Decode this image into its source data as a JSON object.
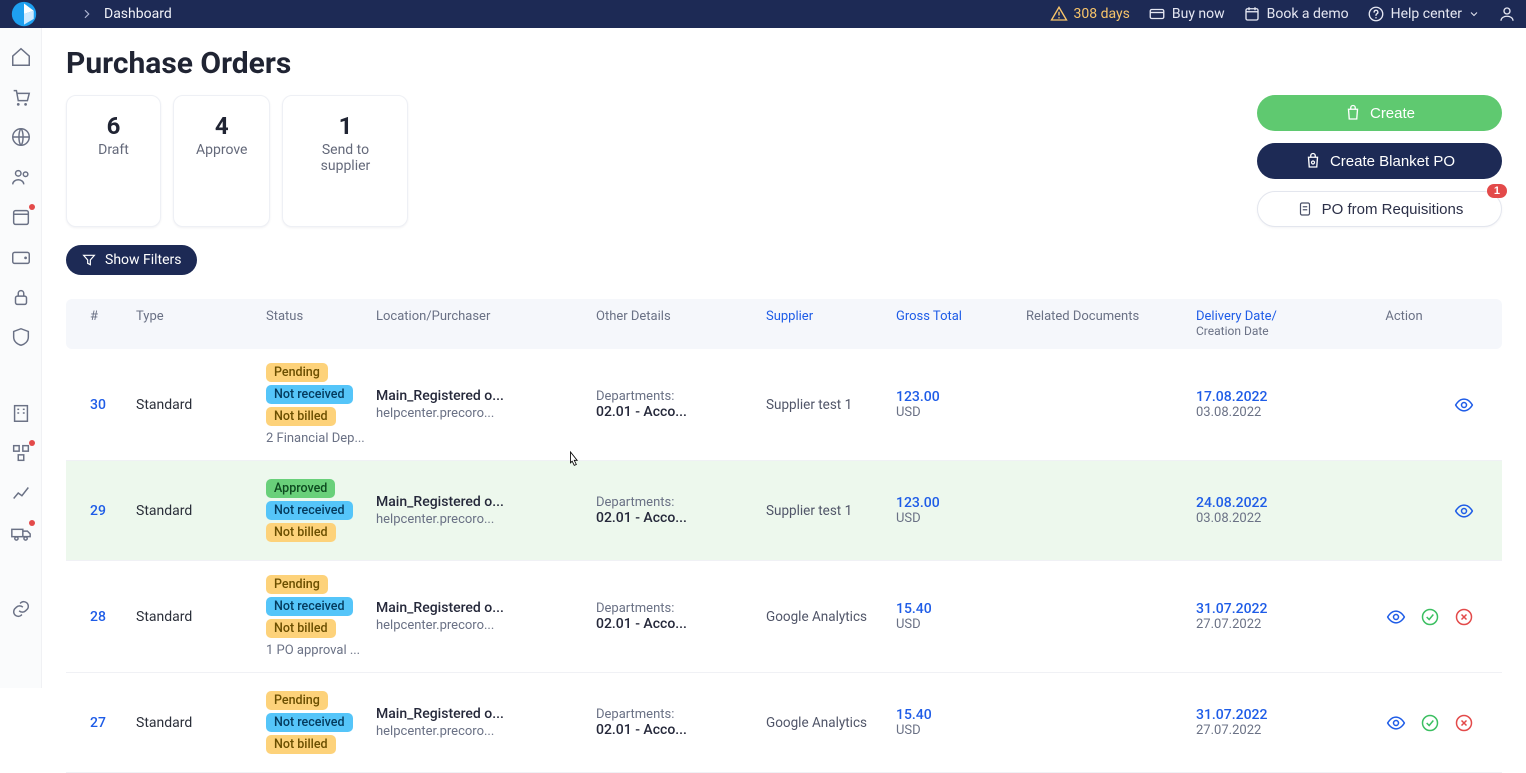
{
  "header": {
    "breadcrumb": "Dashboard",
    "countdown": "308 days",
    "buy_now": "Buy now",
    "book_demo": "Book a demo",
    "help_center": "Help center"
  },
  "page": {
    "title": "Purchase Orders"
  },
  "status_cards": [
    {
      "count": "6",
      "label": "Draft"
    },
    {
      "count": "4",
      "label": "Approve"
    },
    {
      "count": "1",
      "label": "Send to supplier"
    }
  ],
  "buttons": {
    "create": "Create",
    "create_blanket": "Create Blanket PO",
    "po_from_req": "PO from Requisitions",
    "po_from_req_badge": "1",
    "show_filters": "Show Filters"
  },
  "columns": {
    "num": "#",
    "type": "Type",
    "status": "Status",
    "location": "Location/Purchaser",
    "other": "Other Details",
    "supplier": "Supplier",
    "gross": "Gross Total",
    "related": "Related Documents",
    "date1": "Delivery Date/",
    "date2": "Creation Date",
    "action": "Action"
  },
  "rows": [
    {
      "num": "30",
      "type": "Standard",
      "statuses": [
        {
          "text": "Pending",
          "class": "pill-yellow"
        },
        {
          "text": "Not received",
          "class": "pill-blue"
        },
        {
          "text": "Not billed",
          "class": "pill-yellow"
        }
      ],
      "status_extra": "2 Financial Dep...",
      "loc1": "Main_Registered o...",
      "loc2": "helpcenter.precoro...",
      "other1": "Departments:",
      "other2": "02.01 - Acco...",
      "supplier": "Supplier test 1",
      "gross_amount": "123.00",
      "gross_currency": "USD",
      "date1": "17.08.2022",
      "date2": "03.08.2022",
      "actions": [
        "eye"
      ],
      "hovered": false
    },
    {
      "num": "29",
      "type": "Standard",
      "statuses": [
        {
          "text": "Approved",
          "class": "pill-green"
        },
        {
          "text": "Not received",
          "class": "pill-blue"
        },
        {
          "text": "Not billed",
          "class": "pill-yellow"
        }
      ],
      "status_extra": "",
      "loc1": "Main_Registered o...",
      "loc2": "helpcenter.precoro...",
      "other1": "Departments:",
      "other2": "02.01 - Acco...",
      "supplier": "Supplier test 1",
      "gross_amount": "123.00",
      "gross_currency": "USD",
      "date1": "24.08.2022",
      "date2": "03.08.2022",
      "actions": [
        "eye"
      ],
      "hovered": true
    },
    {
      "num": "28",
      "type": "Standard",
      "statuses": [
        {
          "text": "Pending",
          "class": "pill-yellow"
        },
        {
          "text": "Not received",
          "class": "pill-blue"
        },
        {
          "text": "Not billed",
          "class": "pill-yellow"
        }
      ],
      "status_extra": "1 PO approval ...",
      "loc1": "Main_Registered o...",
      "loc2": "helpcenter.precoro...",
      "other1": "Departments:",
      "other2": "02.01 - Acco...",
      "supplier": "Google Analytics",
      "gross_amount": "15.40",
      "gross_currency": "USD",
      "date1": "31.07.2022",
      "date2": "27.07.2022",
      "actions": [
        "eye",
        "check",
        "x"
      ],
      "hovered": false
    },
    {
      "num": "27",
      "type": "Standard",
      "statuses": [
        {
          "text": "Pending",
          "class": "pill-yellow"
        },
        {
          "text": "Not received",
          "class": "pill-blue"
        },
        {
          "text": "Not billed",
          "class": "pill-yellow"
        }
      ],
      "status_extra": "",
      "loc1": "Main_Registered o...",
      "loc2": "helpcenter.precoro...",
      "other1": "Departments:",
      "other2": "02.01 - Acco...",
      "supplier": "Google Analytics",
      "gross_amount": "15.40",
      "gross_currency": "USD",
      "date1": "31.07.2022",
      "date2": "27.07.2022",
      "actions": [
        "eye",
        "check",
        "x"
      ],
      "hovered": false
    }
  ]
}
